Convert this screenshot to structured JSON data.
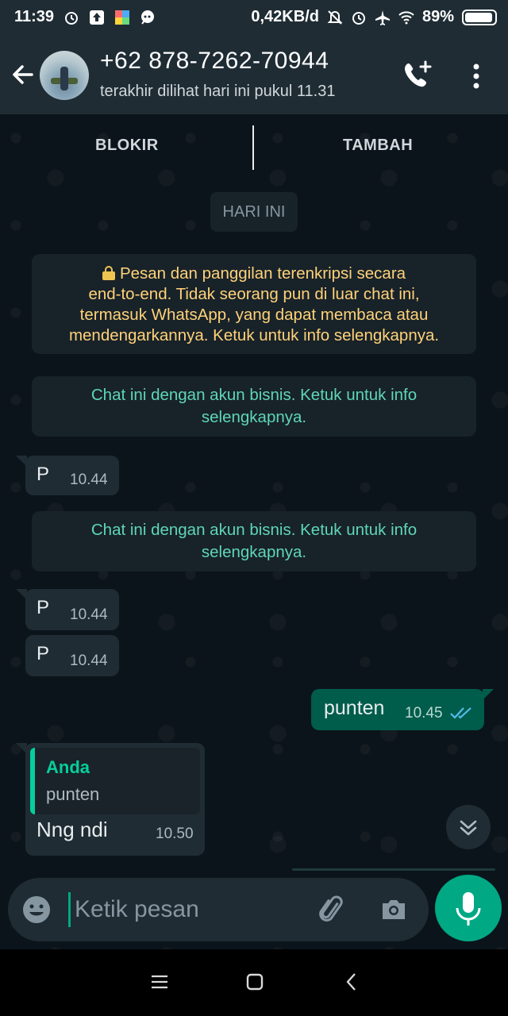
{
  "status_bar": {
    "time": "11:39",
    "net_speed": "0,42KB/d",
    "battery": "89%",
    "icons": [
      "alarm-icon",
      "upload-icon",
      "app-icon",
      "chat-bubble-icon",
      "mute-icon",
      "alarm-icon",
      "airplane-icon",
      "wifi-icon",
      "battery-icon"
    ]
  },
  "header": {
    "contact_name": "+62 878-7262-70944",
    "last_seen": "terakhir dilihat hari ini pukul 11.31",
    "icons": [
      "back-arrow-icon",
      "add-call-icon",
      "more-vert-icon"
    ]
  },
  "actions": {
    "block_label": "BLOKIR",
    "add_label": "TAMBAH"
  },
  "date_chip": "HARI INI",
  "encryption_notice": {
    "icon": "lock-icon",
    "lines": [
      "Pesan dan panggilan terenkripsi secara",
      "end-to-end. Tidak seorang pun di luar chat ini,",
      "termasuk WhatsApp, yang dapat membaca atau",
      "mendengarkannya. Ketuk untuk info selengkapnya."
    ]
  },
  "business_notice": {
    "line1": "Chat ini dengan akun bisnis. Ketuk untuk info",
    "line2": "selengkapnya."
  },
  "messages": [
    {
      "direction": "in",
      "text": "P",
      "time": "10.44"
    },
    {
      "direction": "in",
      "text": "P",
      "time": "10.44"
    },
    {
      "direction": "in",
      "text": "P",
      "time": "10.44"
    },
    {
      "direction": "out",
      "text": "punten",
      "time": "10.45",
      "status": "read"
    },
    {
      "direction": "in",
      "text": "Nng ndi",
      "time": "10.50",
      "quote": {
        "author": "Anda",
        "text": "punten"
      }
    }
  ],
  "composer": {
    "placeholder": "Ketik pesan",
    "icons": [
      "emoji-icon",
      "attach-icon",
      "camera-icon",
      "mic-icon"
    ]
  },
  "colors": {
    "header_bg": "#1f2c34",
    "chat_bg": "#0b141a",
    "outgoing_bubble": "#005c4b",
    "incoming_bubble": "#1f2c34",
    "accent": "#00a884",
    "encryption_text": "#ffd279",
    "business_text": "#5ed6b8"
  }
}
